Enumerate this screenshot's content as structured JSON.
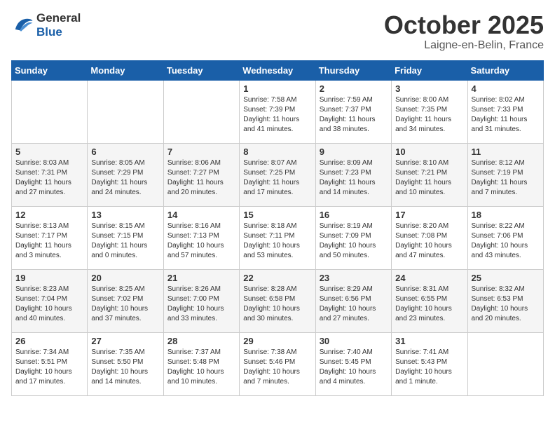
{
  "header": {
    "logo_line1": "General",
    "logo_line2": "Blue",
    "month": "October 2025",
    "location": "Laigne-en-Belin, France"
  },
  "weekdays": [
    "Sunday",
    "Monday",
    "Tuesday",
    "Wednesday",
    "Thursday",
    "Friday",
    "Saturday"
  ],
  "weeks": [
    [
      {
        "day": "",
        "info": ""
      },
      {
        "day": "",
        "info": ""
      },
      {
        "day": "",
        "info": ""
      },
      {
        "day": "1",
        "info": "Sunrise: 7:58 AM\nSunset: 7:39 PM\nDaylight: 11 hours\nand 41 minutes."
      },
      {
        "day": "2",
        "info": "Sunrise: 7:59 AM\nSunset: 7:37 PM\nDaylight: 11 hours\nand 38 minutes."
      },
      {
        "day": "3",
        "info": "Sunrise: 8:00 AM\nSunset: 7:35 PM\nDaylight: 11 hours\nand 34 minutes."
      },
      {
        "day": "4",
        "info": "Sunrise: 8:02 AM\nSunset: 7:33 PM\nDaylight: 11 hours\nand 31 minutes."
      }
    ],
    [
      {
        "day": "5",
        "info": "Sunrise: 8:03 AM\nSunset: 7:31 PM\nDaylight: 11 hours\nand 27 minutes."
      },
      {
        "day": "6",
        "info": "Sunrise: 8:05 AM\nSunset: 7:29 PM\nDaylight: 11 hours\nand 24 minutes."
      },
      {
        "day": "7",
        "info": "Sunrise: 8:06 AM\nSunset: 7:27 PM\nDaylight: 11 hours\nand 20 minutes."
      },
      {
        "day": "8",
        "info": "Sunrise: 8:07 AM\nSunset: 7:25 PM\nDaylight: 11 hours\nand 17 minutes."
      },
      {
        "day": "9",
        "info": "Sunrise: 8:09 AM\nSunset: 7:23 PM\nDaylight: 11 hours\nand 14 minutes."
      },
      {
        "day": "10",
        "info": "Sunrise: 8:10 AM\nSunset: 7:21 PM\nDaylight: 11 hours\nand 10 minutes."
      },
      {
        "day": "11",
        "info": "Sunrise: 8:12 AM\nSunset: 7:19 PM\nDaylight: 11 hours\nand 7 minutes."
      }
    ],
    [
      {
        "day": "12",
        "info": "Sunrise: 8:13 AM\nSunset: 7:17 PM\nDaylight: 11 hours\nand 3 minutes."
      },
      {
        "day": "13",
        "info": "Sunrise: 8:15 AM\nSunset: 7:15 PM\nDaylight: 11 hours\nand 0 minutes."
      },
      {
        "day": "14",
        "info": "Sunrise: 8:16 AM\nSunset: 7:13 PM\nDaylight: 10 hours\nand 57 minutes."
      },
      {
        "day": "15",
        "info": "Sunrise: 8:18 AM\nSunset: 7:11 PM\nDaylight: 10 hours\nand 53 minutes."
      },
      {
        "day": "16",
        "info": "Sunrise: 8:19 AM\nSunset: 7:09 PM\nDaylight: 10 hours\nand 50 minutes."
      },
      {
        "day": "17",
        "info": "Sunrise: 8:20 AM\nSunset: 7:08 PM\nDaylight: 10 hours\nand 47 minutes."
      },
      {
        "day": "18",
        "info": "Sunrise: 8:22 AM\nSunset: 7:06 PM\nDaylight: 10 hours\nand 43 minutes."
      }
    ],
    [
      {
        "day": "19",
        "info": "Sunrise: 8:23 AM\nSunset: 7:04 PM\nDaylight: 10 hours\nand 40 minutes."
      },
      {
        "day": "20",
        "info": "Sunrise: 8:25 AM\nSunset: 7:02 PM\nDaylight: 10 hours\nand 37 minutes."
      },
      {
        "day": "21",
        "info": "Sunrise: 8:26 AM\nSunset: 7:00 PM\nDaylight: 10 hours\nand 33 minutes."
      },
      {
        "day": "22",
        "info": "Sunrise: 8:28 AM\nSunset: 6:58 PM\nDaylight: 10 hours\nand 30 minutes."
      },
      {
        "day": "23",
        "info": "Sunrise: 8:29 AM\nSunset: 6:56 PM\nDaylight: 10 hours\nand 27 minutes."
      },
      {
        "day": "24",
        "info": "Sunrise: 8:31 AM\nSunset: 6:55 PM\nDaylight: 10 hours\nand 23 minutes."
      },
      {
        "day": "25",
        "info": "Sunrise: 8:32 AM\nSunset: 6:53 PM\nDaylight: 10 hours\nand 20 minutes."
      }
    ],
    [
      {
        "day": "26",
        "info": "Sunrise: 7:34 AM\nSunset: 5:51 PM\nDaylight: 10 hours\nand 17 minutes."
      },
      {
        "day": "27",
        "info": "Sunrise: 7:35 AM\nSunset: 5:50 PM\nDaylight: 10 hours\nand 14 minutes."
      },
      {
        "day": "28",
        "info": "Sunrise: 7:37 AM\nSunset: 5:48 PM\nDaylight: 10 hours\nand 10 minutes."
      },
      {
        "day": "29",
        "info": "Sunrise: 7:38 AM\nSunset: 5:46 PM\nDaylight: 10 hours\nand 7 minutes."
      },
      {
        "day": "30",
        "info": "Sunrise: 7:40 AM\nSunset: 5:45 PM\nDaylight: 10 hours\nand 4 minutes."
      },
      {
        "day": "31",
        "info": "Sunrise: 7:41 AM\nSunset: 5:43 PM\nDaylight: 10 hours\nand 1 minute."
      },
      {
        "day": "",
        "info": ""
      }
    ]
  ]
}
